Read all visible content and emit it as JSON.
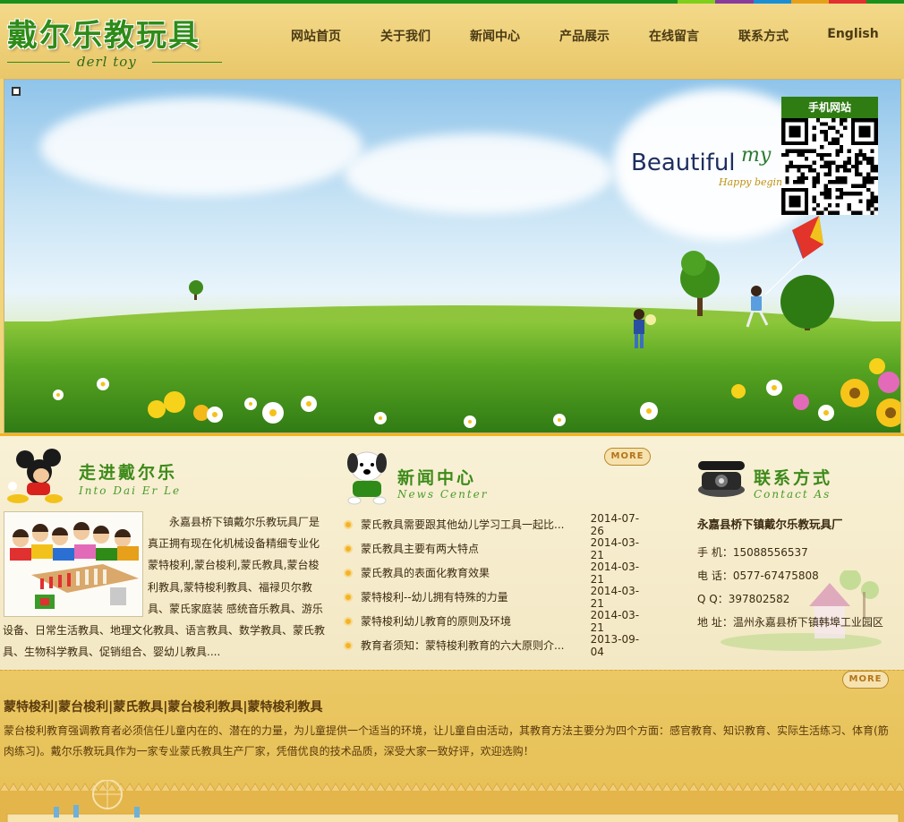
{
  "colors": {
    "strip": [
      "#1d8f1d",
      "#1d8f1d",
      "#1d8f1d",
      "#1d8f1d",
      "#1d8f1d",
      "#1d8f1d",
      "#1d8f1d",
      "#1d8f1d",
      "#1d8f1d",
      "#1d8f1d",
      "#1d8f1d",
      "#1d8f1d",
      "#1d8f1d",
      "#1d8f1d",
      "#1d8f1d",
      "#1d8f1d",
      "#1d8f1d",
      "#1d8f1d",
      "#7fcf1d",
      "#8a3c9c",
      "#1a8fd6",
      "#e6a01a",
      "#e03030",
      "#1d8f1d"
    ],
    "accent": "#2e8b18"
  },
  "logo": {
    "cn": "戴尔乐教玩具",
    "en": "derl toy"
  },
  "nav": [
    "网站首页",
    "关于我们",
    "新闻中心",
    "产品展示",
    "在线留言",
    "联系方式",
    "English"
  ],
  "banner": {
    "headline": "Beautiful",
    "script": "my",
    "tagline": "Happy begin",
    "qr_title": "手机网站"
  },
  "about": {
    "title_cn": "走进戴尔乐",
    "title_en": "Into Dai Er Le",
    "icon": "mickey-icon",
    "text": "永嘉县桥下镇戴尔乐教玩具厂是真正拥有现在化机械设备精细专业化蒙特梭利,蒙台梭利,蒙氏教具,蒙台梭利教具,蒙特梭利教具、福禄贝尔教具、蒙氏家庭装 感统音乐教具、游乐设备、日常生活教具、地理文化教具、语言教具、数学教具、蒙氏教具、生物科学教具、促销组合、婴幼儿教具...."
  },
  "news": {
    "title_cn": "新闻中心",
    "title_en": "News Center",
    "icon": "dog-icon",
    "more": "MORE",
    "items": [
      {
        "title": "蒙氏教具需要跟其他幼儿学习工具一起比...",
        "date": "2014-07-26"
      },
      {
        "title": "蒙氏教具主要有两大特点",
        "date": "2014-03-21"
      },
      {
        "title": "蒙氏教具的表面化教育效果",
        "date": "2014-03-21"
      },
      {
        "title": "蒙特梭利--幼儿拥有特殊的力量",
        "date": "2014-03-21"
      },
      {
        "title": "蒙特梭利幼儿教育的原则及环境",
        "date": "2014-03-21"
      },
      {
        "title": "教育者须知：蒙特梭利教育的六大原则介...",
        "date": "2013-09-04"
      }
    ]
  },
  "contact": {
    "title_cn": "联系方式",
    "title_en": "Contact As",
    "icon": "telephone-icon",
    "company": "永嘉县桥下镇戴尔乐教玩具厂",
    "mobile": "手  机：15088556537",
    "phone": "电  话：0577-67475808",
    "qq": "Q Q：397802582",
    "address": "地  址：温州永嘉县桥下镇韩埠工业园区"
  },
  "bottom": {
    "more": "MORE",
    "title": "蒙特梭利|蒙台梭利|蒙氏教具|蒙台梭利教具|蒙特梭利教具",
    "text": "蒙台梭利教育强调教育者必须信任儿童内在的、潜在的力量，为儿童提供一个适当的环境，让儿童自由活动，其教育方法主要分为四个方面：感官教育、知识教育、实际生活练习、体育(筋肉练习)。戴尔乐教玩具作为一家专业蒙氏教具生产厂家，凭借优良的技术品质，深受大家一致好评，欢迎选购！"
  }
}
